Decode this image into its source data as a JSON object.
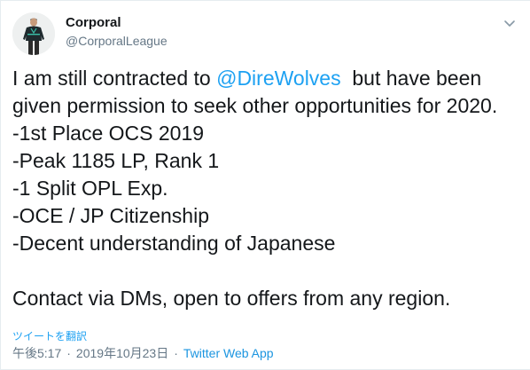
{
  "author": {
    "display_name": "Corporal",
    "handle": "@CorporalLeague",
    "avatar_icon": "player-avatar-icon"
  },
  "tweet": {
    "line1_before": "I am still contracted to ",
    "mention": "@DireWolves",
    "line1_after": "  but have been",
    "line2": "given permission to seek other opportunities for 2020.",
    "bullets": [
      "-1st Place OCS 2019",
      "-Peak 1185 LP, Rank 1",
      "-1 Split OPL Exp.",
      "-OCE / JP Citizenship",
      "-Decent understanding of Japanese"
    ],
    "closing": "Contact via DMs, open to offers from any region."
  },
  "translate_link": "ツイートを翻訳",
  "meta": {
    "time": "午後5:17",
    "separator": "·",
    "date": "2019年10月23日",
    "source": "Twitter Web App"
  },
  "colors": {
    "link": "#1da1f2",
    "secondary_text": "#657786",
    "primary_text": "#14171a"
  }
}
